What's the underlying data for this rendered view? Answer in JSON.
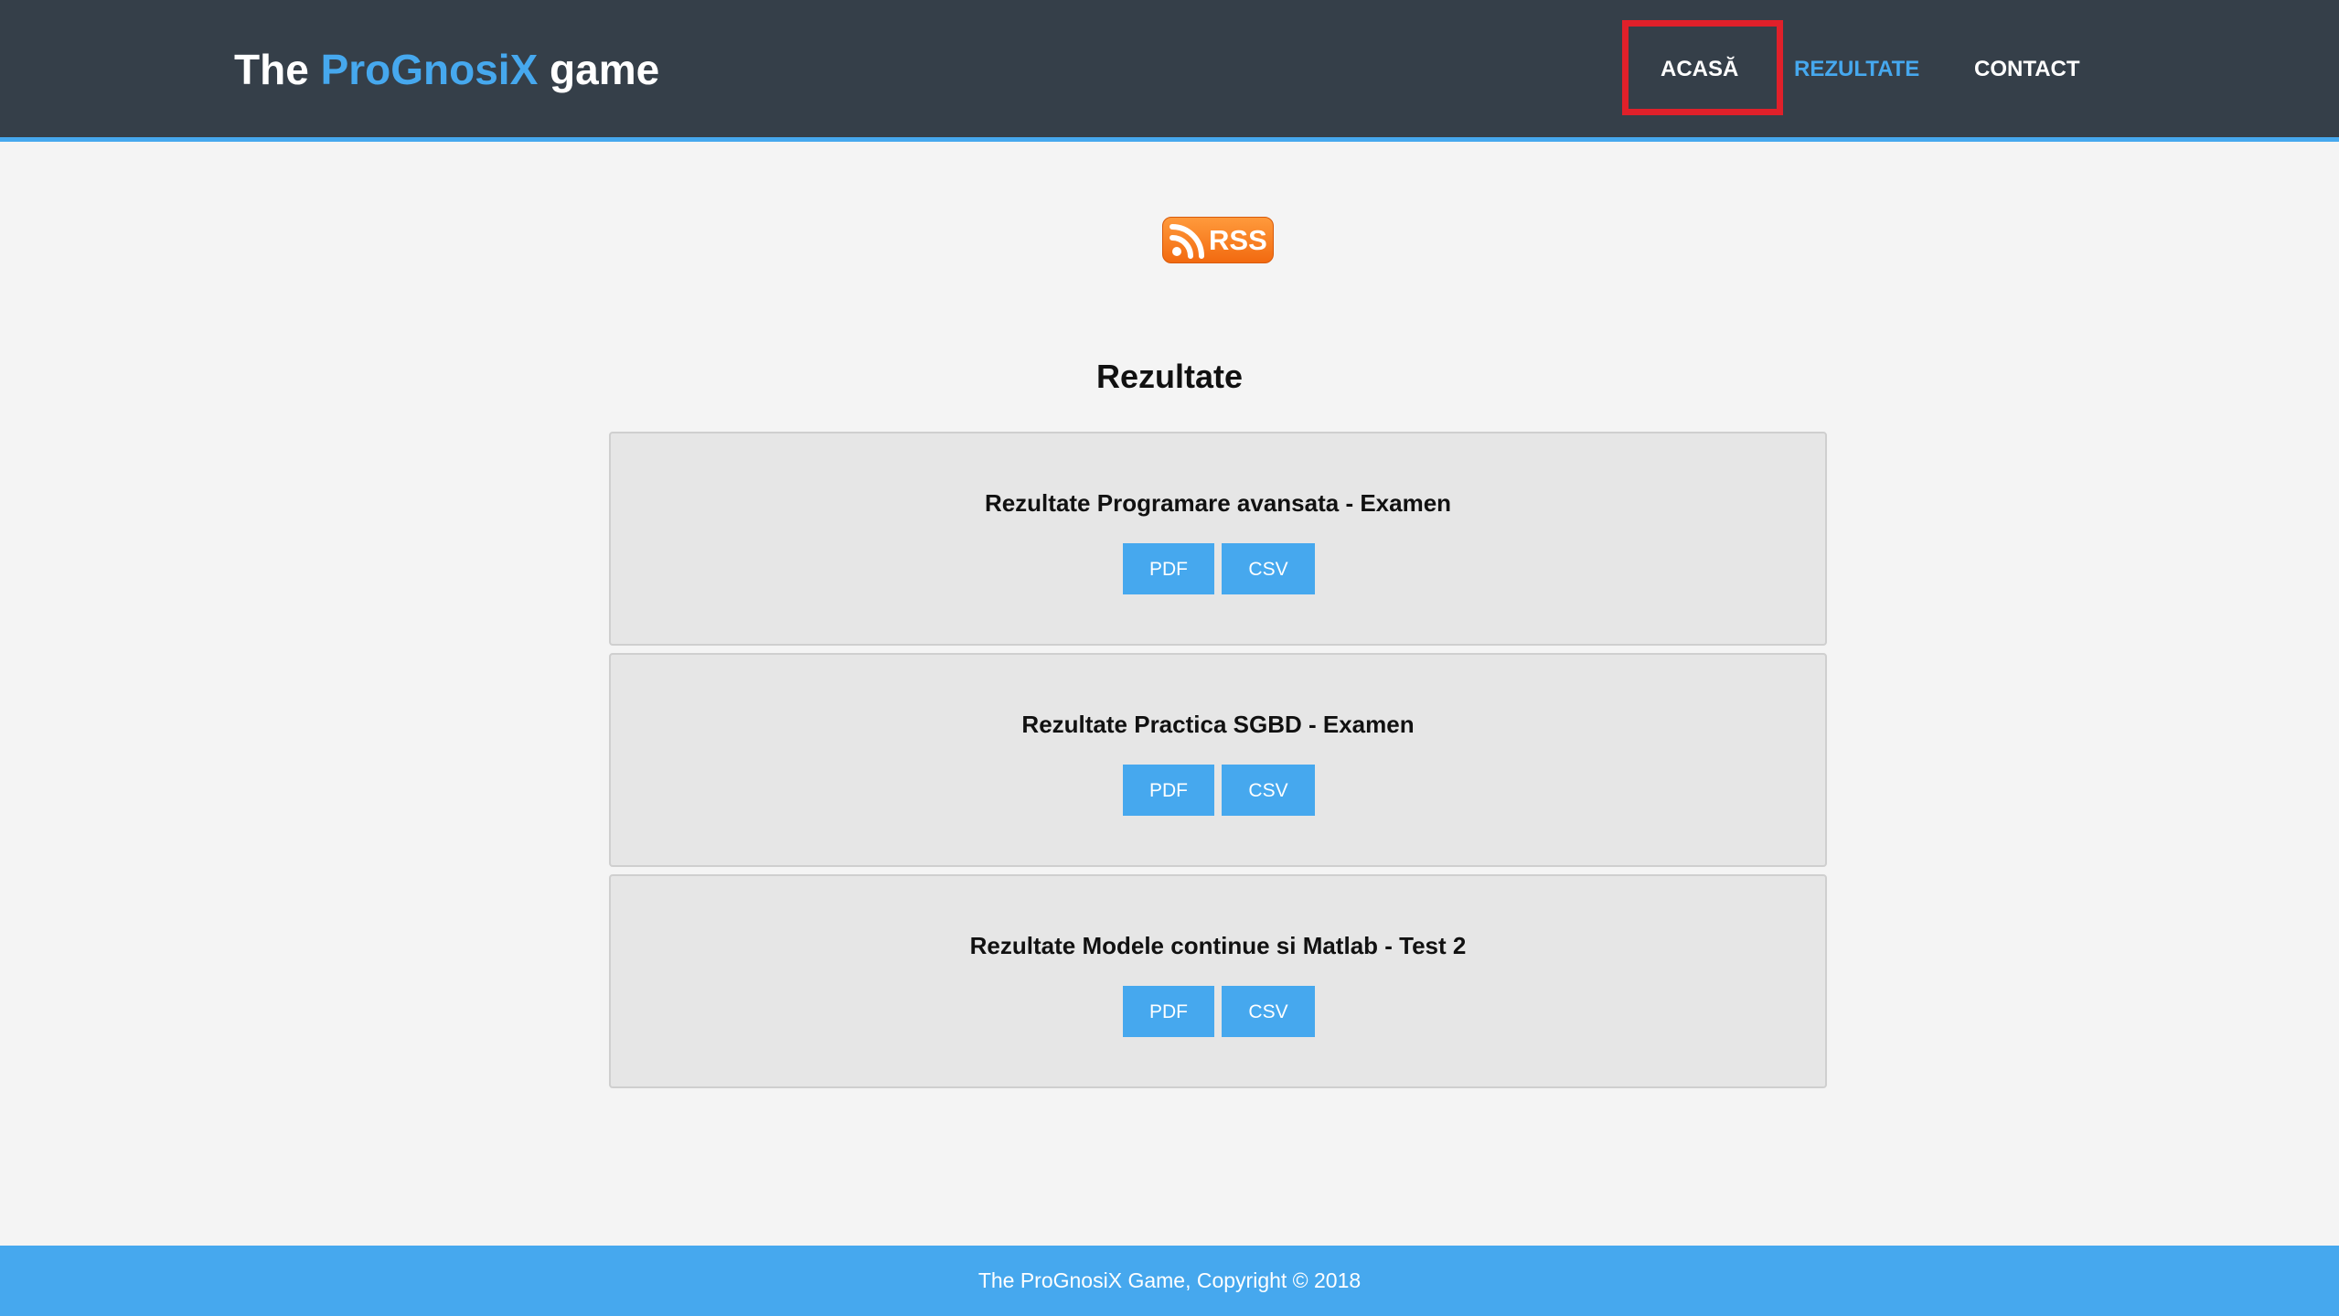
{
  "header": {
    "logo_prefix": "The ",
    "logo_accent": "ProGnosiX",
    "logo_suffix": " game",
    "nav": [
      {
        "label": "ACASĂ"
      },
      {
        "label": "REZULTATE"
      },
      {
        "label": "CONTACT"
      }
    ]
  },
  "rss": {
    "label": "RSS"
  },
  "main": {
    "title": "Rezultate",
    "cards": [
      {
        "title": "Rezultate Programare avansata - Examen",
        "pdf": "PDF",
        "csv": "CSV"
      },
      {
        "title": "Rezultate Practica SGBD - Examen",
        "pdf": "PDF",
        "csv": "CSV"
      },
      {
        "title": "Rezultate Modele continue si Matlab - Test 2",
        "pdf": "PDF",
        "csv": "CSV"
      }
    ]
  },
  "footer": {
    "text": "The ProGnosiX Game, Copyright © 2018"
  },
  "colors": {
    "header_bg": "#353f49",
    "accent": "#46a8ee",
    "highlight": "#e0202a",
    "rss": "#f26a10"
  }
}
